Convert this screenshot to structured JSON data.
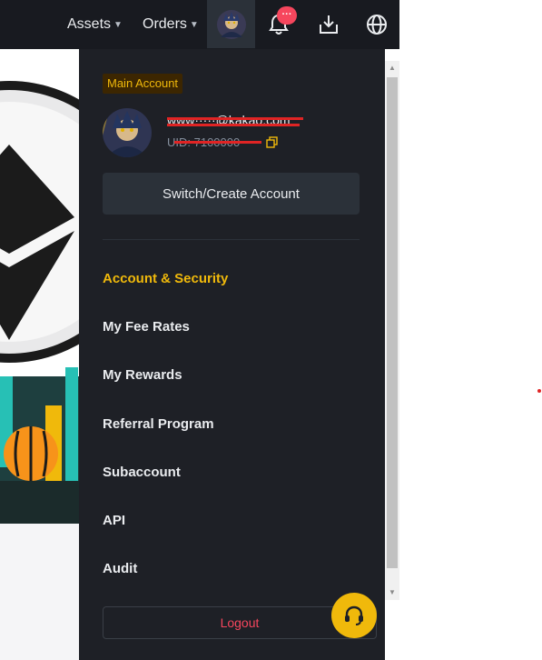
{
  "header": {
    "assets_label": "Assets",
    "orders_label": "Orders",
    "notification_badge": "···"
  },
  "account": {
    "tag": "Main Account",
    "email": "www·····@kakao.com",
    "uid": "UID: 7100000",
    "switch_label": "Switch/Create Account"
  },
  "menu": {
    "items": [
      {
        "label": "Account & Security",
        "active": true
      },
      {
        "label": "My Fee Rates",
        "active": false
      },
      {
        "label": "My Rewards",
        "active": false
      },
      {
        "label": "Referral Program",
        "active": false
      },
      {
        "label": "Subaccount",
        "active": false
      },
      {
        "label": "API",
        "active": false
      },
      {
        "label": "Audit",
        "active": false
      }
    ],
    "logout_label": "Logout"
  },
  "colors": {
    "accent": "#f0b90b",
    "danger": "#f6465d",
    "panel_bg": "#1e2026",
    "topbar_bg": "#181a20"
  }
}
